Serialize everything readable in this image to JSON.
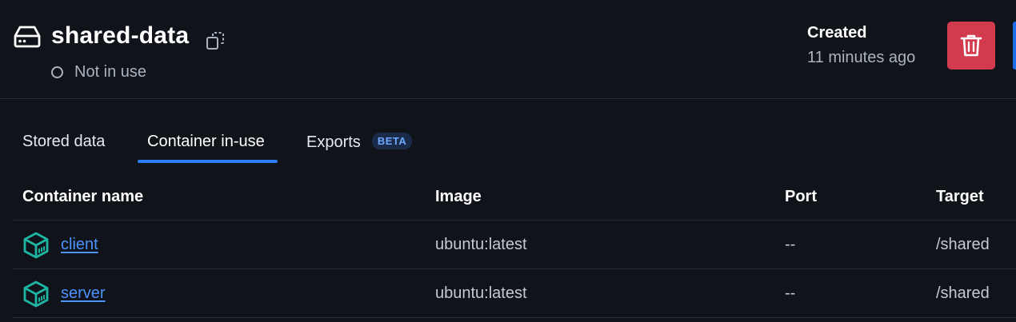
{
  "volume": {
    "name": "shared-data",
    "status": "Not in use",
    "created_label": "Created",
    "created_value": "11 minutes ago"
  },
  "icons": {
    "volume": "hard-drive-icon",
    "copy": "copy-icon",
    "delete": "trash-icon",
    "container": "container-cube-icon"
  },
  "tabs": [
    {
      "label": "Stored data",
      "active": false
    },
    {
      "label": "Container in-use",
      "active": true
    },
    {
      "label": "Exports",
      "active": false,
      "badge": "BETA"
    }
  ],
  "table": {
    "columns": [
      "Container name",
      "Image",
      "Port",
      "Target"
    ],
    "rows": [
      {
        "name": "client",
        "image": "ubuntu:latest",
        "port": "--",
        "target": "/shared"
      },
      {
        "name": "server",
        "image": "ubuntu:latest",
        "port": "--",
        "target": "/shared"
      }
    ]
  },
  "colors": {
    "background": "#101319",
    "accent": "#2d7ff9",
    "danger": "#d23a4e",
    "container_icon": "#1fb5a3",
    "link": "#4d93ff"
  }
}
